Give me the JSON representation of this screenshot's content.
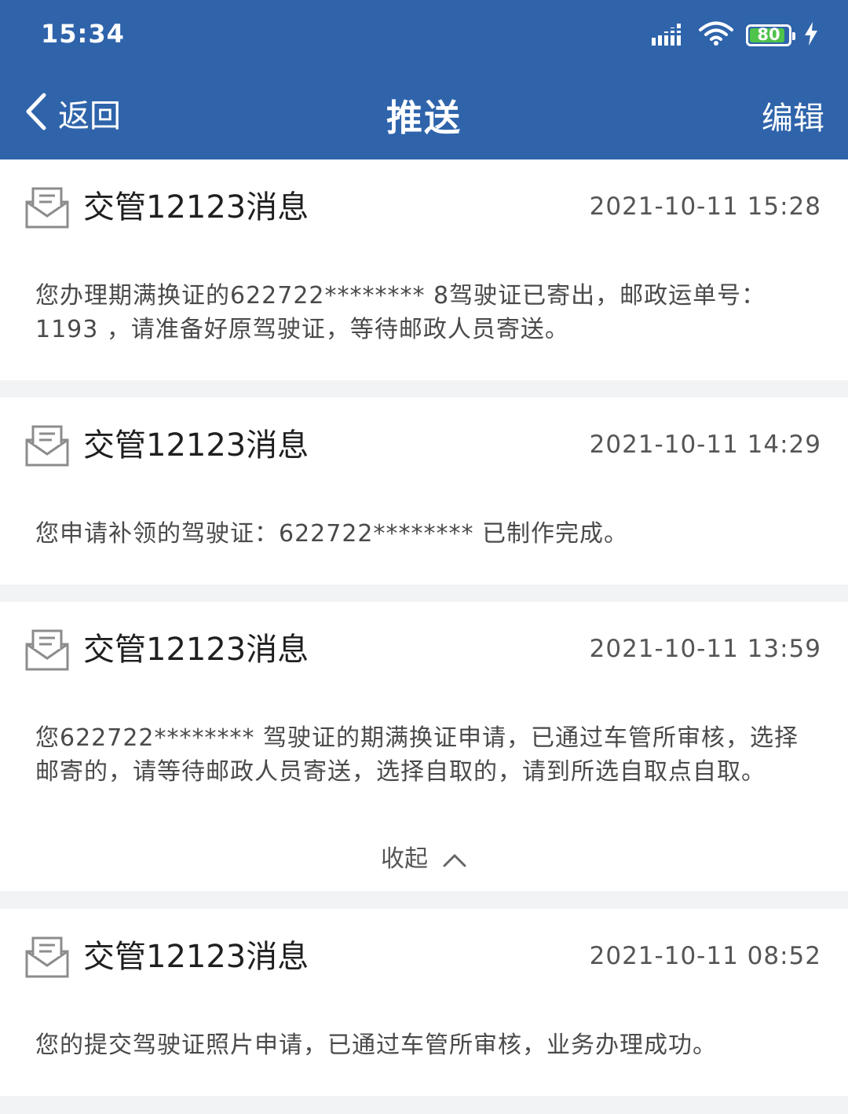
{
  "status_bar": {
    "time": "15:34",
    "battery_level": "80",
    "icons": [
      "signal-icon",
      "wifi-icon",
      "battery-icon",
      "charging-icon"
    ]
  },
  "nav": {
    "back_label": "返回",
    "title": "推送",
    "edit_label": "编辑"
  },
  "messages": [
    {
      "sender": "交管12123消息",
      "time": "2021-10-11 15:28",
      "body": "您办理期满换证的622722********        8驾驶证已寄出，邮政运单号：1193          ，请准备好原驾驶证，等待邮政人员寄送。"
    },
    {
      "sender": "交管12123消息",
      "time": "2021-10-11 14:29",
      "body": "您申请补领的驾驶证：622722********        已制作完成。"
    },
    {
      "sender": "交管12123消息",
      "time": "2021-10-11 13:59",
      "body": "您622722********     驾驶证的期满换证申请，已通过车管所审核，选择邮寄的，请等待邮政人员寄送，选择自取的，请到所选自取点自取。",
      "collapse_label": "收起"
    },
    {
      "sender": "交管12123消息",
      "time": "2021-10-11 08:52",
      "body": "您的提交驾驶证照片申请，已通过车管所审核，业务办理成功。"
    }
  ],
  "colors": {
    "header_bg": "#2f64ab",
    "page_bg": "#f2f3f5",
    "card_bg": "#ffffff",
    "battery_fill": "#4fc34a"
  }
}
